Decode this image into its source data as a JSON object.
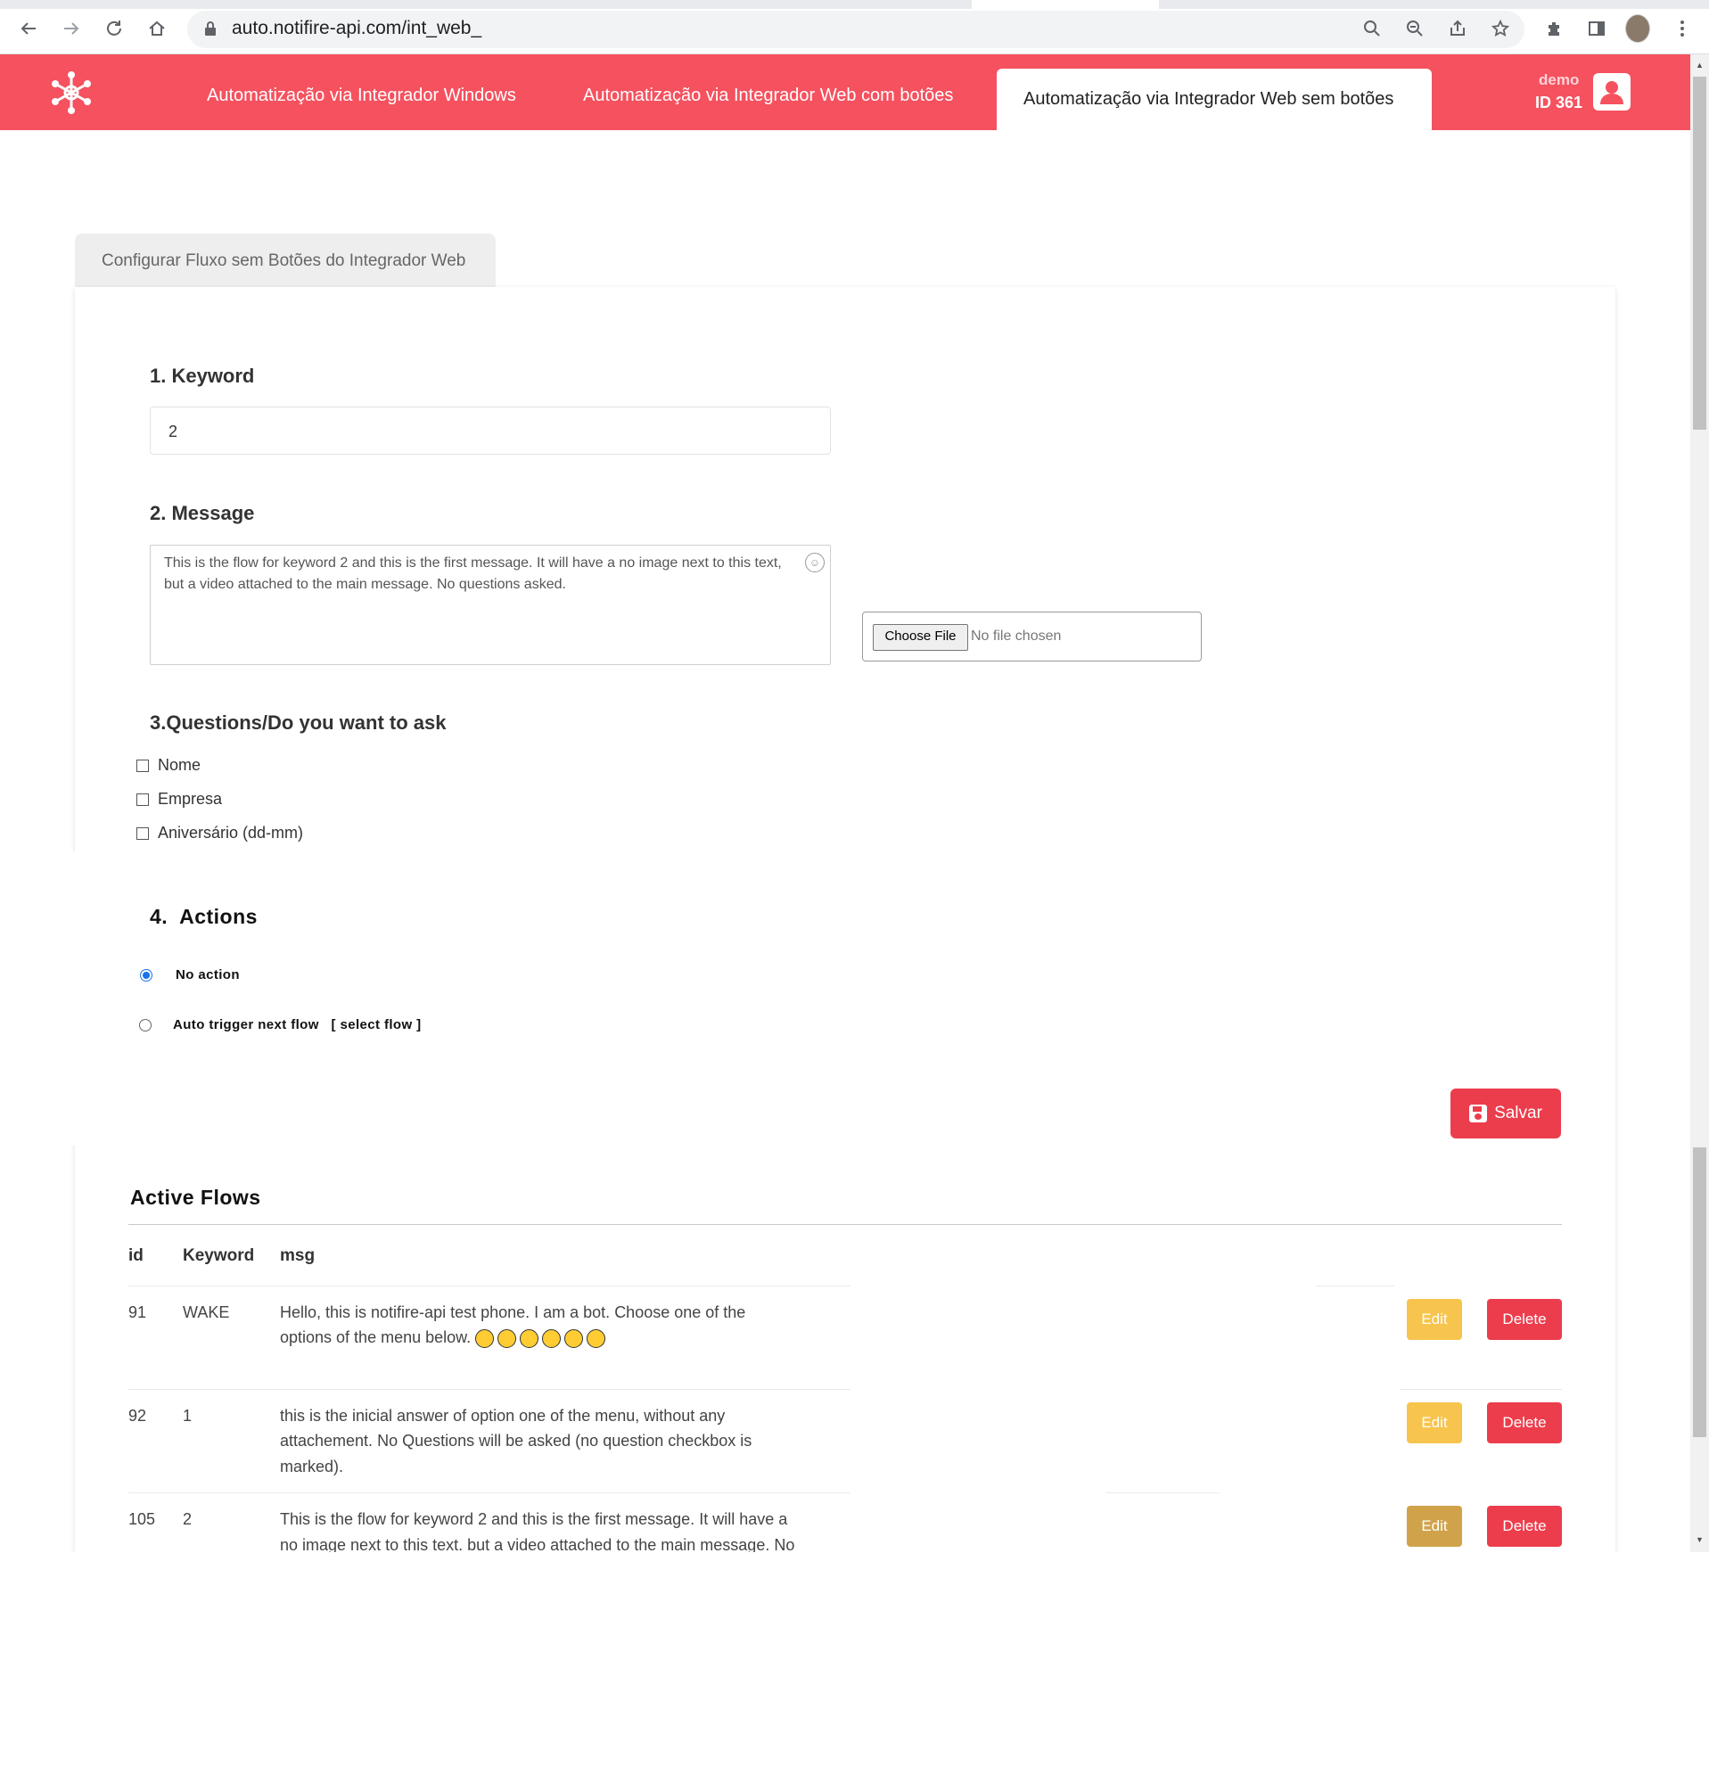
{
  "browser": {
    "url": "auto.notifire-api.com/int_web_"
  },
  "header": {
    "tabs": [
      "Automatização via Integrador Windows",
      "Automatização via Integrador Web com botões",
      "Automatização via Integrador Web sem botões"
    ],
    "active_tab_index": 2,
    "user_name": "demo",
    "user_id": "ID 361"
  },
  "section_tab": "Configurar Fluxo sem Botões do Integrador Web",
  "form": {
    "keyword_label": "1. Keyword",
    "keyword_value": "2",
    "message_label": "2. Message",
    "message_value": "This is the flow for keyword 2 and this is the first message.  It will have a no image next to this text, but a video attached to the main message. No questions asked.",
    "choose_file_label": "Choose File",
    "no_file_text": "No file chosen",
    "questions_label": "3.Questions/Do you want to ask",
    "questions": [
      {
        "label": "Nome",
        "checked": false
      },
      {
        "label": "Empresa",
        "checked": false
      },
      {
        "label": "Aniversário (dd-mm)",
        "checked": false
      }
    ],
    "actions_label": "4.  Actions",
    "actions": [
      {
        "label": "No action",
        "selected": true
      },
      {
        "label": "Auto trigger next flow   [ select flow ]",
        "selected": false
      }
    ],
    "save_label": "Salvar"
  },
  "active_flows": {
    "title": "Active Flows",
    "columns": [
      "id",
      "Keyword",
      "msg"
    ],
    "rows": [
      {
        "id": "91",
        "keyword": "WAKE",
        "msg_line1": "Hello, this is notifire-api test phone. I am a bot. Choose one of the",
        "msg_line2": "options of the menu below.",
        "msg_line3": ""
      },
      {
        "id": "92",
        "keyword": "1",
        "msg_line1": "this is the inicial answer of option one of the menu, without any",
        "msg_line2": "attachement. No Questions will be asked (no question checkbox is",
        "msg_line3": "marked)."
      },
      {
        "id": "105",
        "keyword": "2",
        "msg_line1": "This is the flow for keyword 2 and this is the first message. It will have a",
        "msg_line2": "no image next to this text. but a video attached to the main message. No",
        "msg_line3": ""
      }
    ],
    "edit_label": "Edit",
    "delete_label": "Delete"
  }
}
